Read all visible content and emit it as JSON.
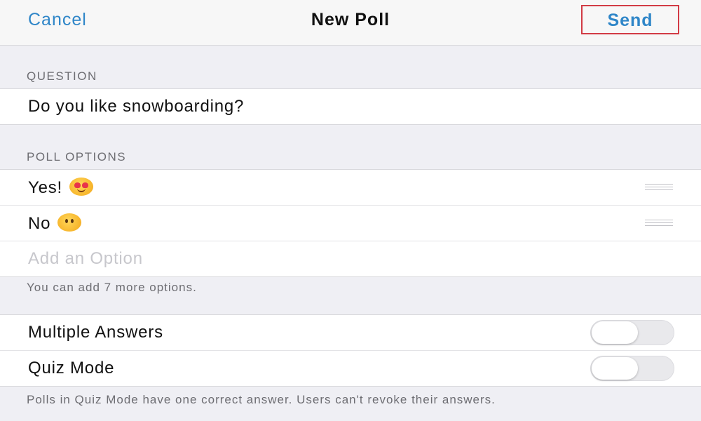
{
  "nav": {
    "cancel_label": "Cancel",
    "title": "New Poll",
    "send_label": "Send"
  },
  "question": {
    "header": "QUESTION",
    "value": "Do you like snowboarding?"
  },
  "poll_options": {
    "header": "POLL OPTIONS",
    "options": [
      {
        "label": "Yes!",
        "emoji": "smiling-face-with-heart-eyes"
      },
      {
        "label": "No",
        "emoji": "face-without-mouth"
      }
    ],
    "add_placeholder": "Add an Option",
    "footer": "You can add 7 more options."
  },
  "settings": {
    "multiple_answers": {
      "label": "Multiple Answers",
      "enabled": false
    },
    "quiz_mode": {
      "label": "Quiz Mode",
      "enabled": false
    },
    "footer": "Polls in Quiz Mode have one correct answer. Users can't revoke their answers."
  },
  "colors": {
    "accent": "#2f86c8",
    "highlight_border": "#d23b45",
    "background": "#efeff4"
  }
}
